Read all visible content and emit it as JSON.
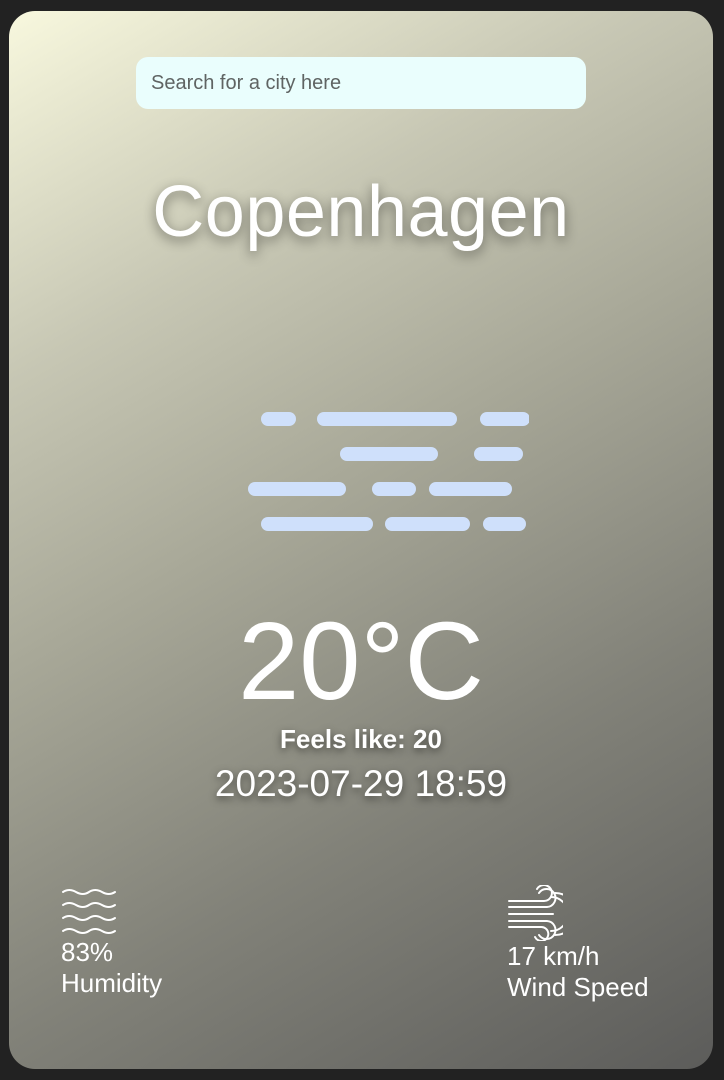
{
  "search": {
    "placeholder": "Search for a city here",
    "value": ""
  },
  "location": {
    "city": "Copenhagen"
  },
  "current": {
    "condition_icon": "fog-icon",
    "temperature": "20°C",
    "feels_like": "Feels like: 20",
    "datetime": "2023-07-29 18:59"
  },
  "stats": {
    "humidity": {
      "icon": "waves-icon",
      "value": "83%",
      "label": "Humidity"
    },
    "wind": {
      "icon": "wind-icon",
      "value": "17 km/h",
      "label": "Wind Speed"
    }
  },
  "colors": {
    "fog": "#cfe0fb",
    "search_bg": "#eafefd",
    "page_bg": "#222222"
  }
}
